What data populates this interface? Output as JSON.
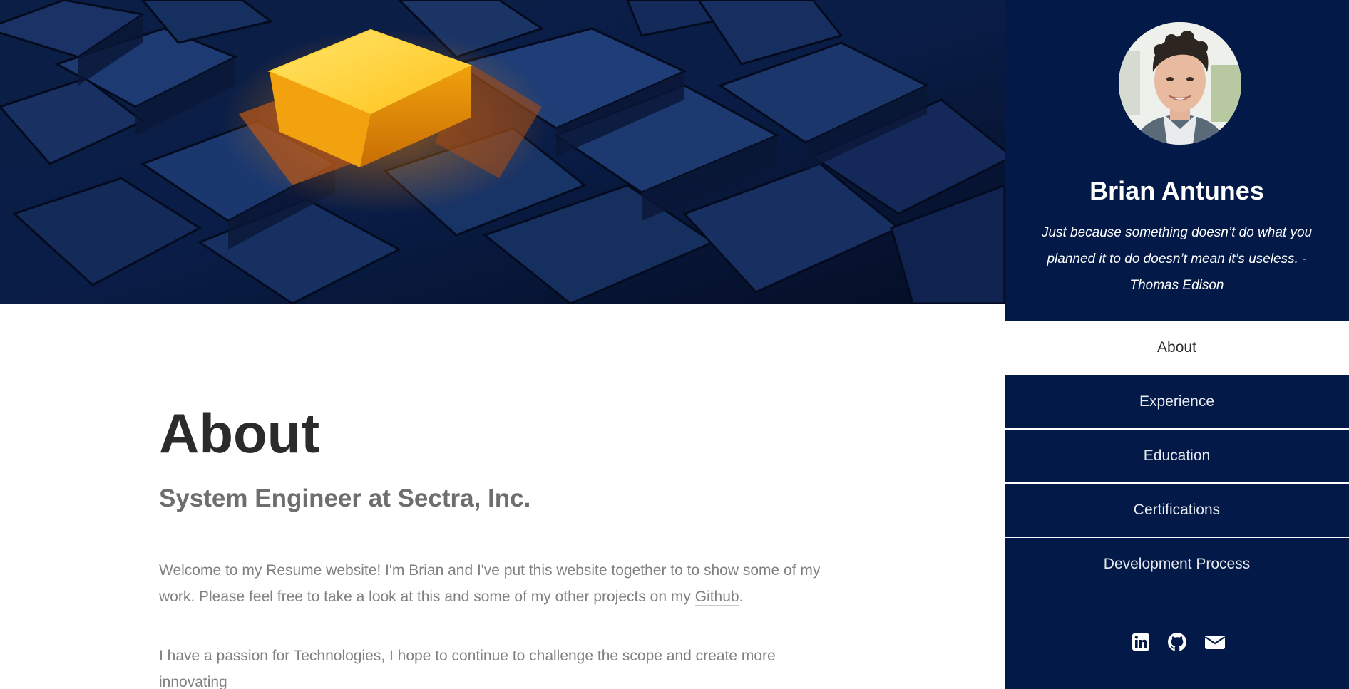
{
  "main": {
    "title": "About",
    "subtitle": "System Engineer at Sectra, Inc.",
    "intro_text": "Welcome to my Resume website! I'm Brian and I've put this website together to to show some of my work. Please feel free to take a look at this and some of my other projects on my ",
    "github_link_text": "Github",
    "intro_end": ".",
    "paragraph_2": "I have a passion for Technologies, I hope to continue to challenge the scope and create more innovating"
  },
  "sidebar": {
    "name": "Brian Antunes",
    "quote": "Just because something doesn’t do what you planned it to do doesn’t mean it’s useless. - Thomas Edison",
    "nav": [
      {
        "label": "About",
        "active": true
      },
      {
        "label": "Experience",
        "active": false
      },
      {
        "label": "Education",
        "active": false
      },
      {
        "label": "Certifications",
        "active": false
      },
      {
        "label": "Development Process",
        "active": false
      }
    ],
    "social_icons": [
      "linkedin-icon",
      "github-icon",
      "envelope-icon"
    ]
  },
  "colors": {
    "sidebar_bg": "#031a48",
    "accent_cube": "#ffc21a",
    "title_text": "#2b2b2b",
    "body_text": "#808080"
  }
}
